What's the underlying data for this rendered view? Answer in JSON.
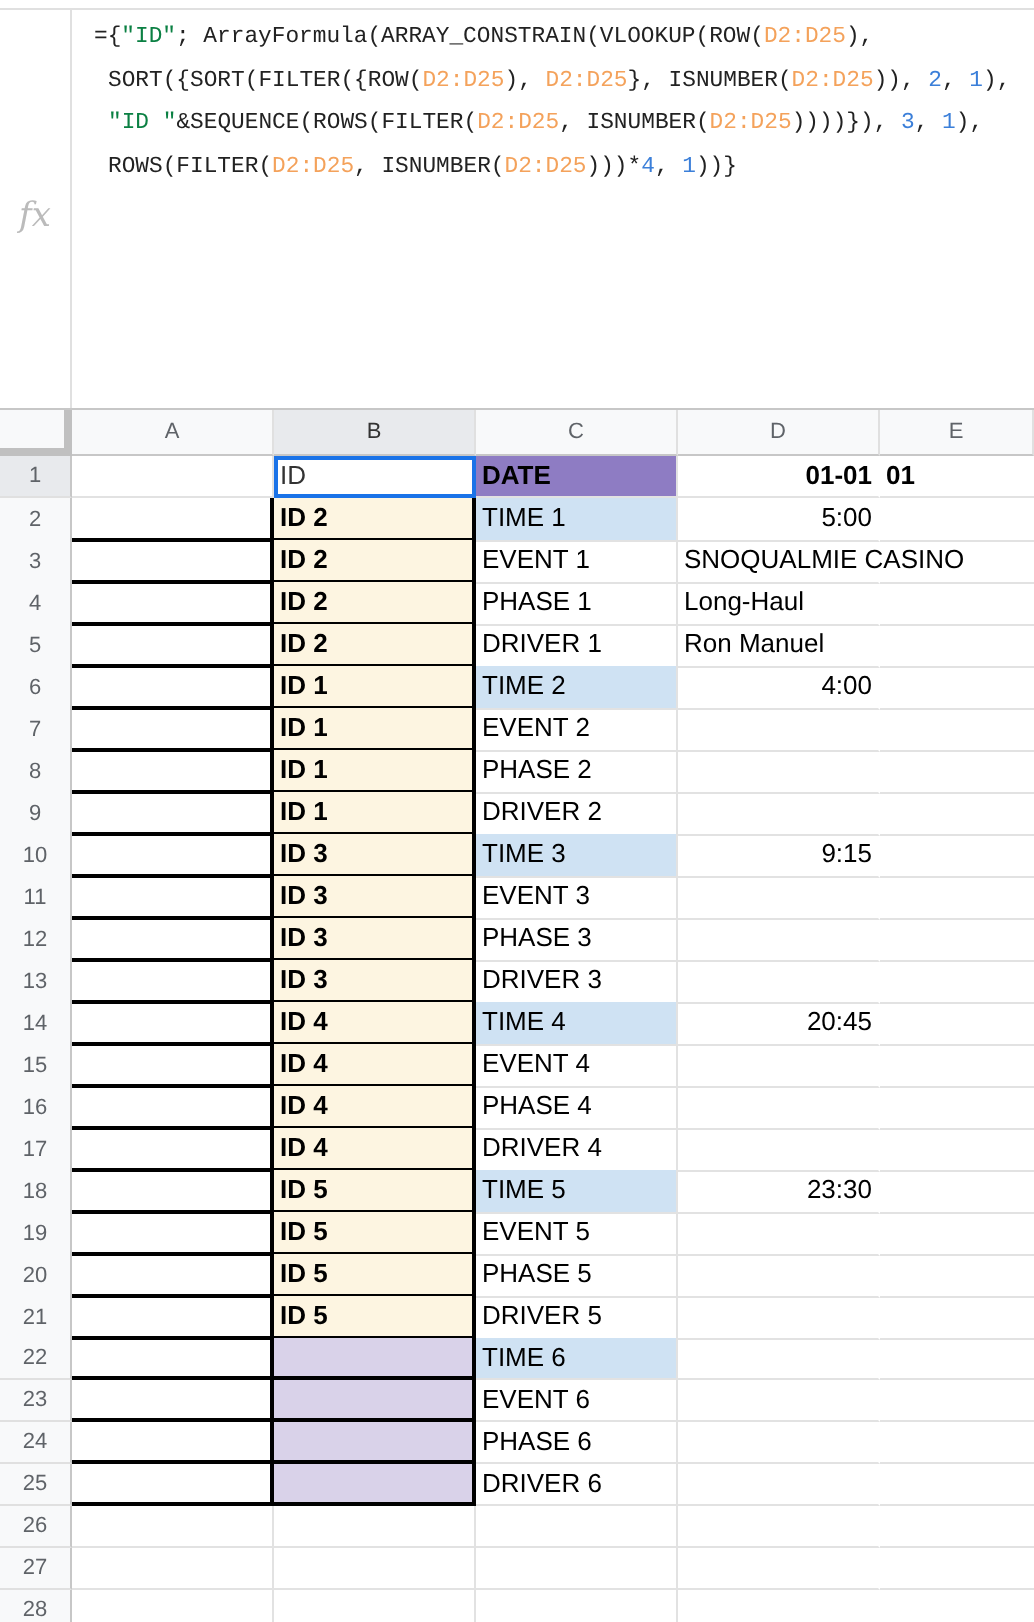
{
  "formula_bar": {
    "label": "fx",
    "lines": [
      [
        {
          "kind": "plain",
          "text": "={"
        },
        {
          "kind": "string",
          "text": "\"ID\""
        },
        {
          "kind": "plain",
          "text": "; ArrayFormula(ARRAY_CONSTRAIN(VLOOKUP(ROW("
        },
        {
          "kind": "range",
          "text": "D2:D25"
        },
        {
          "kind": "plain",
          "text": "),"
        }
      ],
      [
        {
          "kind": "plain",
          "text": "SORT({SORT(FILTER({ROW("
        },
        {
          "kind": "range",
          "text": "D2:D25"
        },
        {
          "kind": "plain",
          "text": "), "
        },
        {
          "kind": "range",
          "text": "D2:D25"
        },
        {
          "kind": "plain",
          "text": "}, ISNUMBER("
        },
        {
          "kind": "range",
          "text": "D2:D25"
        },
        {
          "kind": "plain",
          "text": ")), "
        },
        {
          "kind": "number",
          "text": "2"
        },
        {
          "kind": "plain",
          "text": ", "
        },
        {
          "kind": "number",
          "text": "1"
        },
        {
          "kind": "plain",
          "text": "),"
        }
      ],
      [
        {
          "kind": "string",
          "text": "\"ID \""
        },
        {
          "kind": "plain",
          "text": "&SEQUENCE(ROWS(FILTER("
        },
        {
          "kind": "range",
          "text": "D2:D25"
        },
        {
          "kind": "plain",
          "text": ", ISNUMBER("
        },
        {
          "kind": "range",
          "text": "D2:D25"
        },
        {
          "kind": "plain",
          "text": "))))}), "
        },
        {
          "kind": "number",
          "text": "3"
        },
        {
          "kind": "plain",
          "text": ", "
        },
        {
          "kind": "number",
          "text": "1"
        },
        {
          "kind": "plain",
          "text": "),"
        }
      ],
      [
        {
          "kind": "plain",
          "text": "ROWS(FILTER("
        },
        {
          "kind": "range",
          "text": "D2:D25"
        },
        {
          "kind": "plain",
          "text": ", ISNUMBER("
        },
        {
          "kind": "range",
          "text": "D2:D25"
        },
        {
          "kind": "plain",
          "text": ")))*"
        },
        {
          "kind": "number",
          "text": "4"
        },
        {
          "kind": "plain",
          "text": ", "
        },
        {
          "kind": "number",
          "text": "1"
        },
        {
          "kind": "plain",
          "text": "))}"
        }
      ]
    ]
  },
  "columns": [
    {
      "label": "A",
      "selected": false
    },
    {
      "label": "B",
      "selected": true
    },
    {
      "label": "C",
      "selected": false
    },
    {
      "label": "D",
      "selected": false
    },
    {
      "label": "E",
      "selected": false
    }
  ],
  "rows": [
    {
      "num": "1",
      "selected": true,
      "b": "ID",
      "c": "DATE",
      "c_header": true,
      "d": "01-01",
      "d_right": true,
      "d_bold": true,
      "e": "01"
    },
    {
      "num": "2",
      "selected": false,
      "boxed": true,
      "b": "ID 2",
      "b_shaded": true,
      "c": "TIME 1",
      "c_time": true,
      "d": "5:00",
      "d_right": true
    },
    {
      "num": "3",
      "selected": false,
      "boxed": true,
      "b": "ID 2",
      "b_shaded": true,
      "c": "EVENT 1",
      "d": "SNOQUALMIE CASINO"
    },
    {
      "num": "4",
      "selected": false,
      "boxed": true,
      "b": "ID 2",
      "b_shaded": true,
      "c": "PHASE 1",
      "d": "Long-Haul"
    },
    {
      "num": "5",
      "selected": false,
      "boxed": true,
      "b": "ID 2",
      "b_shaded": true,
      "c": "DRIVER 1",
      "d": "Ron Manuel"
    },
    {
      "num": "6",
      "selected": false,
      "boxed": true,
      "b": "ID 1",
      "b_shaded": true,
      "c": "TIME 2",
      "c_time": true,
      "d": "4:00",
      "d_right": true
    },
    {
      "num": "7",
      "selected": false,
      "boxed": true,
      "b": "ID 1",
      "b_shaded": true,
      "c": "EVENT 2"
    },
    {
      "num": "8",
      "selected": false,
      "boxed": true,
      "b": "ID 1",
      "b_shaded": true,
      "c": "PHASE 2"
    },
    {
      "num": "9",
      "selected": false,
      "boxed": true,
      "b": "ID 1",
      "b_shaded": true,
      "c": "DRIVER 2"
    },
    {
      "num": "10",
      "selected": false,
      "boxed": true,
      "b": "ID 3",
      "b_shaded": true,
      "c": "TIME 3",
      "c_time": true,
      "d": "9:15",
      "d_right": true
    },
    {
      "num": "11",
      "selected": false,
      "boxed": true,
      "b": "ID 3",
      "b_shaded": true,
      "c": "EVENT 3"
    },
    {
      "num": "12",
      "selected": false,
      "boxed": true,
      "b": "ID 3",
      "b_shaded": true,
      "c": "PHASE 3"
    },
    {
      "num": "13",
      "selected": false,
      "boxed": true,
      "b": "ID 3",
      "b_shaded": true,
      "c": "DRIVER 3"
    },
    {
      "num": "14",
      "selected": false,
      "boxed": true,
      "b": "ID 4",
      "b_shaded": true,
      "c": "TIME 4",
      "c_time": true,
      "d": "20:45",
      "d_right": true
    },
    {
      "num": "15",
      "selected": false,
      "boxed": true,
      "b": "ID 4",
      "b_shaded": true,
      "c": "EVENT 4"
    },
    {
      "num": "16",
      "selected": false,
      "boxed": true,
      "b": "ID 4",
      "b_shaded": true,
      "c": "PHASE 4"
    },
    {
      "num": "17",
      "selected": false,
      "boxed": true,
      "b": "ID 4",
      "b_shaded": true,
      "c": "DRIVER 4"
    },
    {
      "num": "18",
      "selected": false,
      "boxed": true,
      "b": "ID 5",
      "b_shaded": true,
      "c": "TIME 5",
      "c_time": true,
      "d": "23:30",
      "d_right": true
    },
    {
      "num": "19",
      "selected": false,
      "boxed": true,
      "b": "ID 5",
      "b_shaded": true,
      "c": "EVENT 5"
    },
    {
      "num": "20",
      "selected": false,
      "boxed": true,
      "b": "ID 5",
      "b_shaded": true,
      "c": "PHASE 5"
    },
    {
      "num": "21",
      "selected": false,
      "boxed": true,
      "b": "ID 5",
      "b_shaded": true,
      "c": "DRIVER 5"
    },
    {
      "num": "22",
      "selected": false,
      "boxed": true,
      "b_missing": true,
      "c": "TIME 6",
      "c_time": true
    },
    {
      "num": "23",
      "selected": false,
      "boxed": true,
      "b_missing": true,
      "c": "EVENT 6"
    },
    {
      "num": "24",
      "selected": false,
      "boxed": true,
      "b_missing": true,
      "c": "PHASE 6"
    },
    {
      "num": "25",
      "selected": false,
      "boxed": true,
      "b_missing": true,
      "c": "DRIVER 6"
    },
    {
      "num": "26",
      "selected": false
    },
    {
      "num": "27",
      "selected": false
    },
    {
      "num": "28",
      "selected": false
    }
  ]
}
